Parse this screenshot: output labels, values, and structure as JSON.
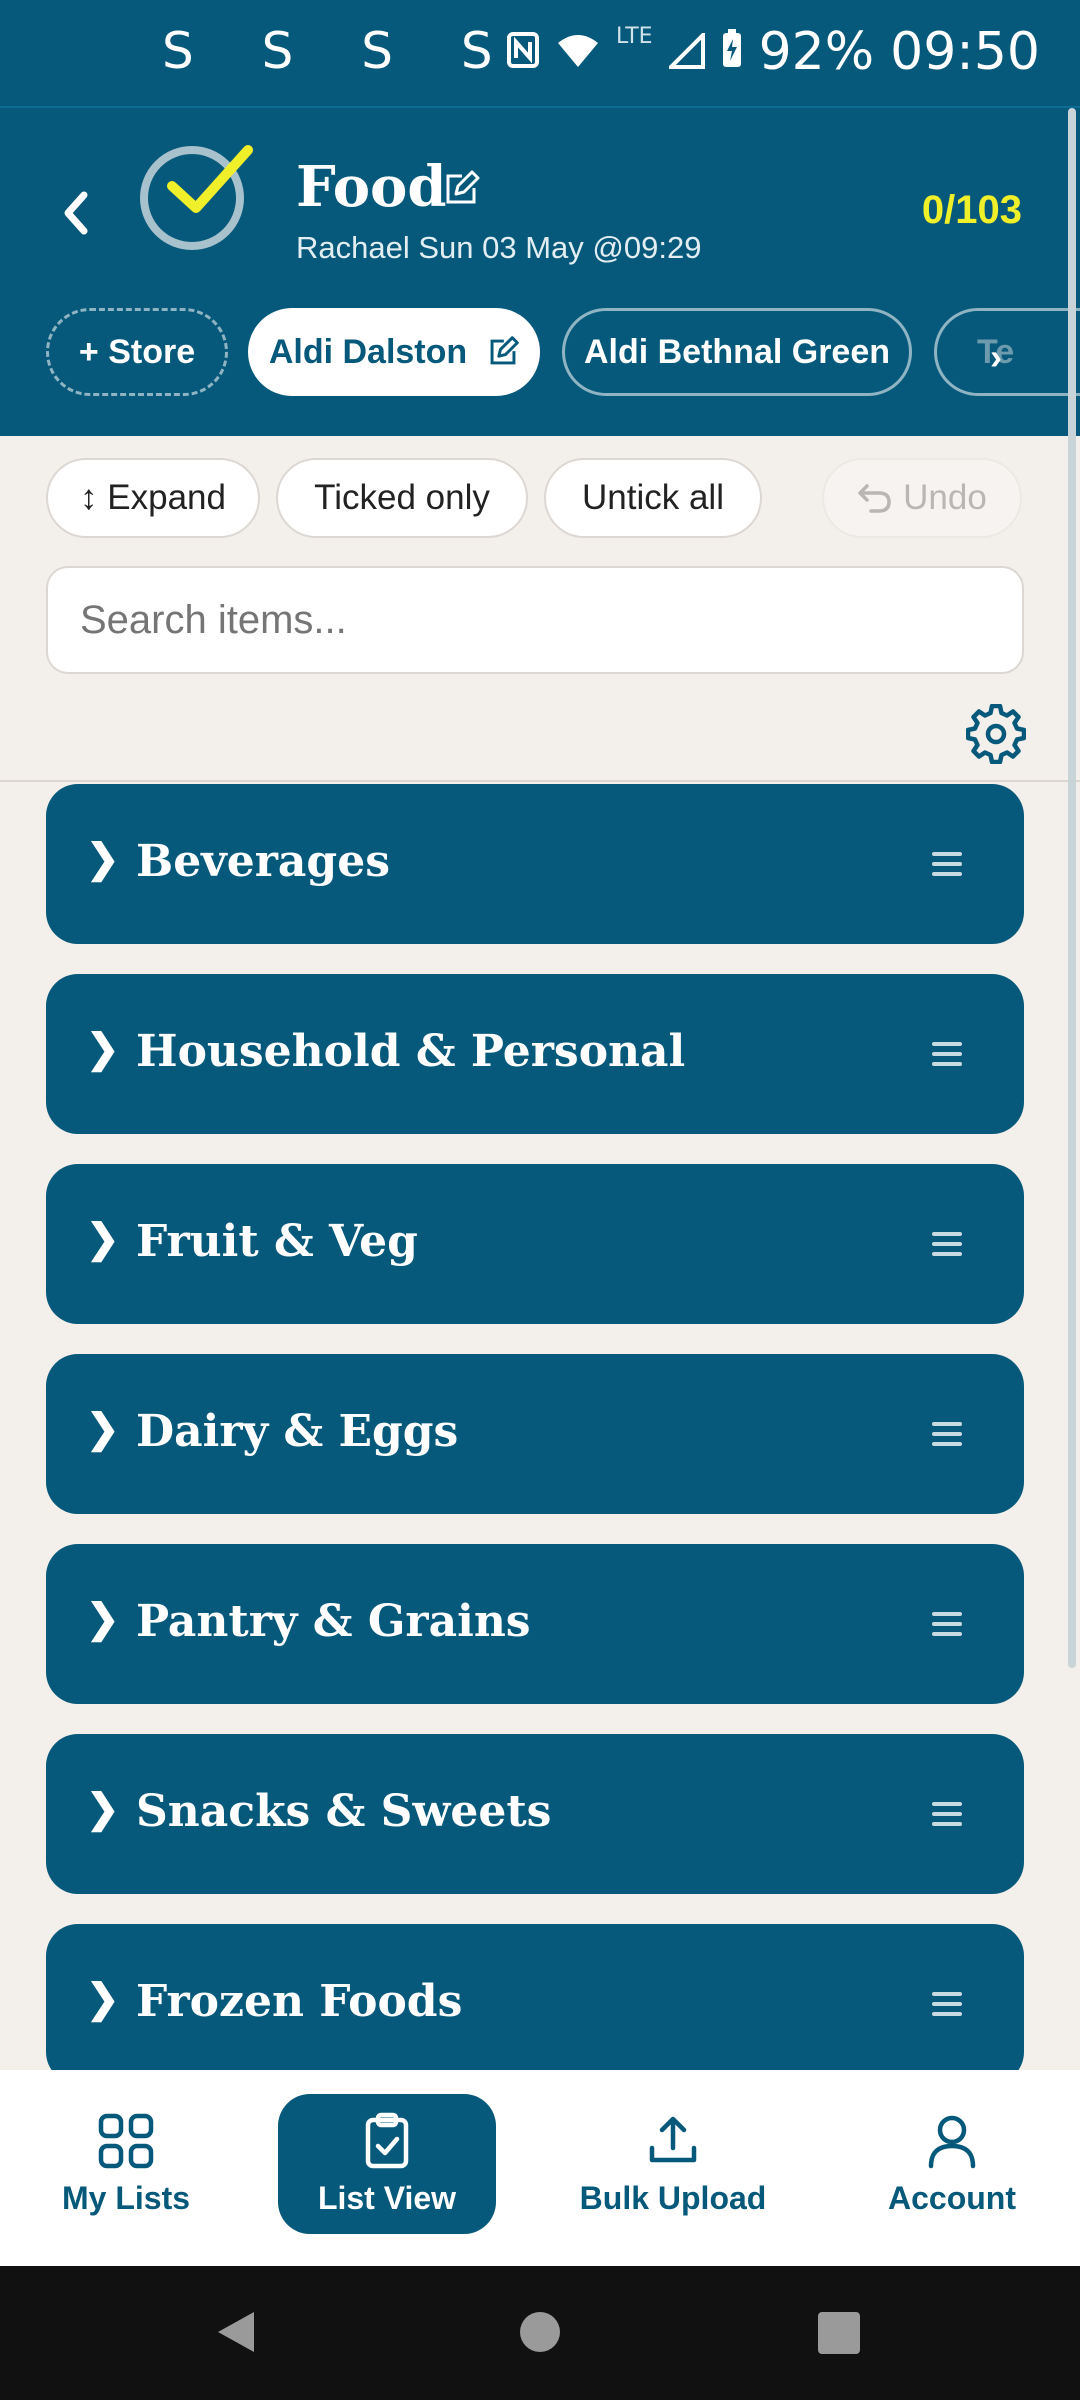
{
  "status_bar": {
    "notifications": "S S S S •",
    "network": "LTE",
    "battery": "92%",
    "time": "09:50"
  },
  "header": {
    "title": "Food",
    "subtitle": "Rachael Sun 03 May @09:29",
    "progress": "0/103"
  },
  "stores": {
    "add_label": "+ Store",
    "active": "Aldi Dalston",
    "other": "Aldi Bethnal Green",
    "partial": "Te"
  },
  "toolbar": {
    "expand": "↕ Expand",
    "ticked_only": "Ticked only",
    "untick_all": "Untick all",
    "undo": "Undo"
  },
  "search": {
    "placeholder": "Search items..."
  },
  "categories": [
    {
      "name": "Beverages"
    },
    {
      "name": "Household & Personal"
    },
    {
      "name": "Fruit & Veg"
    },
    {
      "name": "Dairy & Eggs"
    },
    {
      "name": "Pantry & Grains"
    },
    {
      "name": "Snacks & Sweets"
    },
    {
      "name": "Frozen Foods"
    }
  ],
  "bottom_nav": {
    "my_lists": "My Lists",
    "list_view": "List View",
    "bulk_upload": "Bulk Upload",
    "account": "Account"
  },
  "colors": {
    "primary": "#06597a",
    "accent": "#f0f02a",
    "background": "#f3efeb"
  }
}
